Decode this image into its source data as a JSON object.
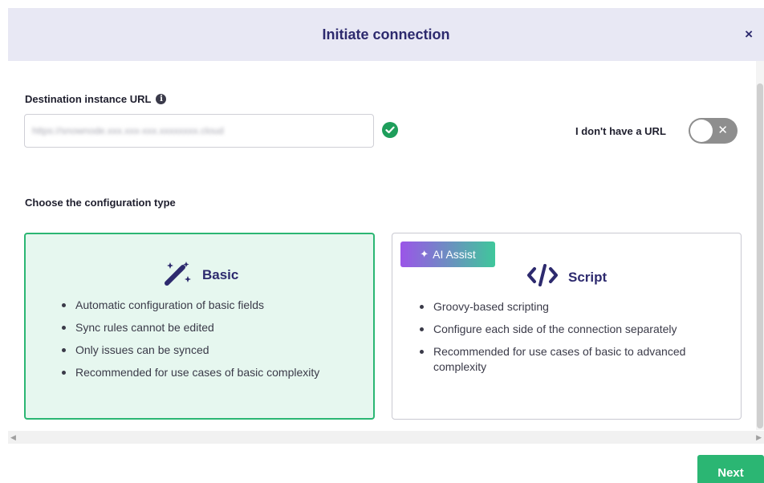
{
  "header": {
    "title": "Initiate connection",
    "close_label": "×"
  },
  "destination": {
    "label": "Destination instance URL",
    "info_glyph": "i",
    "url_value": "https://snownode.xxx.xxx-xxx.xxxxxxxx.cloud",
    "status": "valid"
  },
  "no_url": {
    "label": "I don't have a URL",
    "toggle_on": false,
    "toggle_glyph": "✕"
  },
  "config": {
    "title": "Choose the configuration type",
    "basic": {
      "title": "Basic",
      "selected": true,
      "bullets": [
        "Automatic configuration of basic fields",
        "Sync rules cannot be edited",
        "Only issues can be synced",
        "Recommended for use cases of basic complexity"
      ]
    },
    "script": {
      "title": "Script",
      "badge": "AI Assist",
      "bullets": [
        "Groovy-based scripting",
        "Configure each side of the connection separately",
        "Recommended for use cases of basic to advanced complexity"
      ]
    }
  },
  "footer": {
    "next_label": "Next"
  },
  "colors": {
    "accent": "#2bb673",
    "brand": "#2d2a6e",
    "header_bg": "#e8e8f4",
    "badge_from": "#9b55e8",
    "badge_to": "#3fc79b"
  }
}
